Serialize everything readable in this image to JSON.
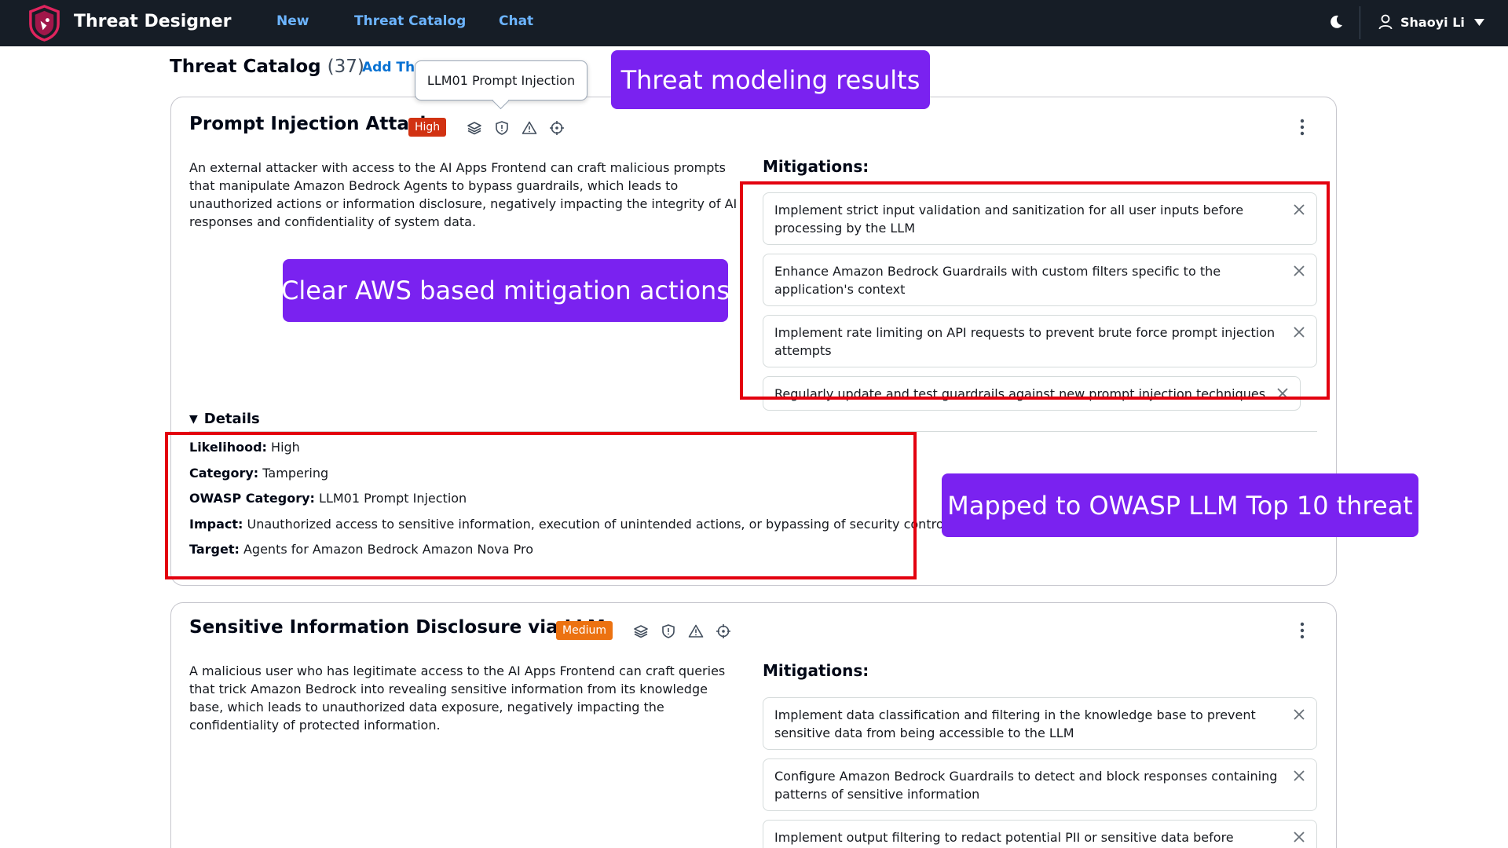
{
  "app": {
    "title": "Threat Designer"
  },
  "nav": {
    "new": "New",
    "catalog": "Threat Catalog",
    "chat": "Chat"
  },
  "user": {
    "name": "Shaoyi Li"
  },
  "page": {
    "title": "Threat Catalog",
    "count": "(37)",
    "add_threat": "Add Thr"
  },
  "tooltip": {
    "text": "LLM01 Prompt Injection"
  },
  "callouts": {
    "results": "Threat modeling results",
    "mitigation": "Clear AWS based mitigation actions",
    "owasp": "Mapped to OWASP LLM Top 10 threat"
  },
  "colors": {
    "nav_bg": "#161d26",
    "link": "#6cb4ff",
    "callout": "#7a22f0",
    "high": "#d13212",
    "medium": "#ec7211",
    "highlight": "#e3000f"
  },
  "icons": [
    "layers-icon",
    "shield-icon",
    "warning-icon",
    "target-icon"
  ],
  "threats": [
    {
      "title": "Prompt Injection Attack",
      "severity": "High",
      "description": "An external attacker with access to the AI Apps Frontend can craft malicious prompts that manipulate Amazon Bedrock Agents to bypass guardrails, which leads to unauthorized actions or information disclosure, negatively impacting the integrity of AI responses and confidentiality of system data.",
      "mitigations_label": "Mitigations:",
      "mitigations": [
        "Implement strict input validation and sanitization for all user inputs before processing by the LLM",
        "Enhance Amazon Bedrock Guardrails with custom filters specific to the application's context",
        "Implement rate limiting on API requests to prevent brute force prompt injection attempts",
        "Regularly update and test guardrails against new prompt injection techniques"
      ],
      "details_label": "Details",
      "details": {
        "likelihood_label": "Likelihood:",
        "likelihood": "High",
        "category_label": "Category:",
        "category": "Tampering",
        "owasp_label": "OWASP Category:",
        "owasp": "LLM01 Prompt Injection",
        "impact_label": "Impact:",
        "impact": "Unauthorized access to sensitive information, execution of unintended actions, or bypassing of security controls",
        "target_label": "Target:",
        "target": "Agents for Amazon Bedrock Amazon Nova Pro"
      }
    },
    {
      "title": "Sensitive Information Disclosure via LLM",
      "severity": "Medium",
      "description": "A malicious user who has legitimate access to the AI Apps Frontend can craft queries that trick Amazon Bedrock into revealing sensitive information from its knowledge base, which leads to unauthorized data exposure, negatively impacting the confidentiality of protected information.",
      "mitigations_label": "Mitigations:",
      "mitigations": [
        "Implement data classification and filtering in the knowledge base to prevent sensitive data from being accessible to the LLM",
        "Configure Amazon Bedrock Guardrails to detect and block responses containing patterns of sensitive information",
        "Implement output filtering to redact potential PII or sensitive data before returning responses to users"
      ]
    }
  ]
}
